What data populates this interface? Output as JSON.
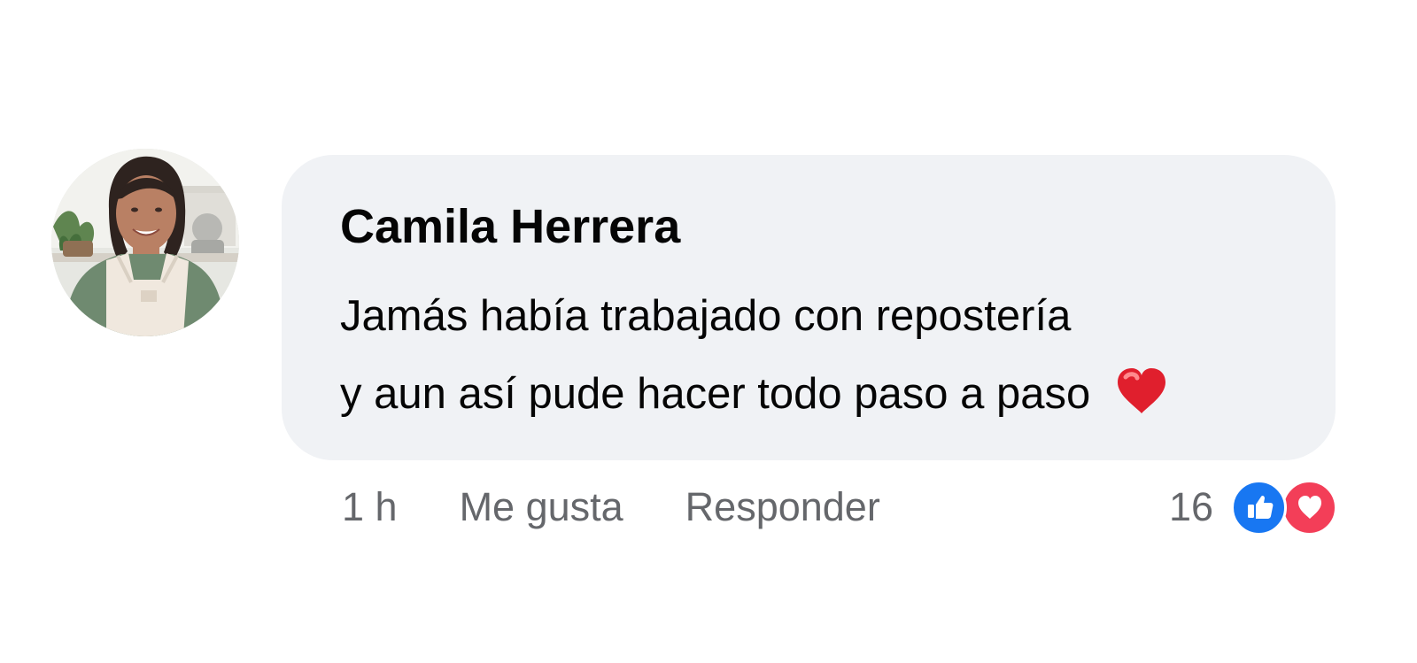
{
  "comment": {
    "author_name": "Camila Herrera",
    "message_lines": [
      "Jamás había trabajado con repostería",
      "y aun así pude hacer todo paso a paso"
    ],
    "message_emoji_icon": "red-heart-emoji-icon",
    "timestamp": "1 h",
    "actions": {
      "like_label": "Me gusta",
      "reply_label": "Responder"
    },
    "reactions": {
      "count": "16",
      "icons": [
        "like-reaction-icon",
        "love-reaction-icon"
      ]
    },
    "avatar_icon": "user-avatar"
  },
  "colors": {
    "bubble_background": "#f0f2f5",
    "primary_text": "#050505",
    "secondary_text": "#65676b",
    "like_blue": "#1877f2",
    "love_red": "#f33e58",
    "emoji_heart_red": "#e01f2d"
  }
}
